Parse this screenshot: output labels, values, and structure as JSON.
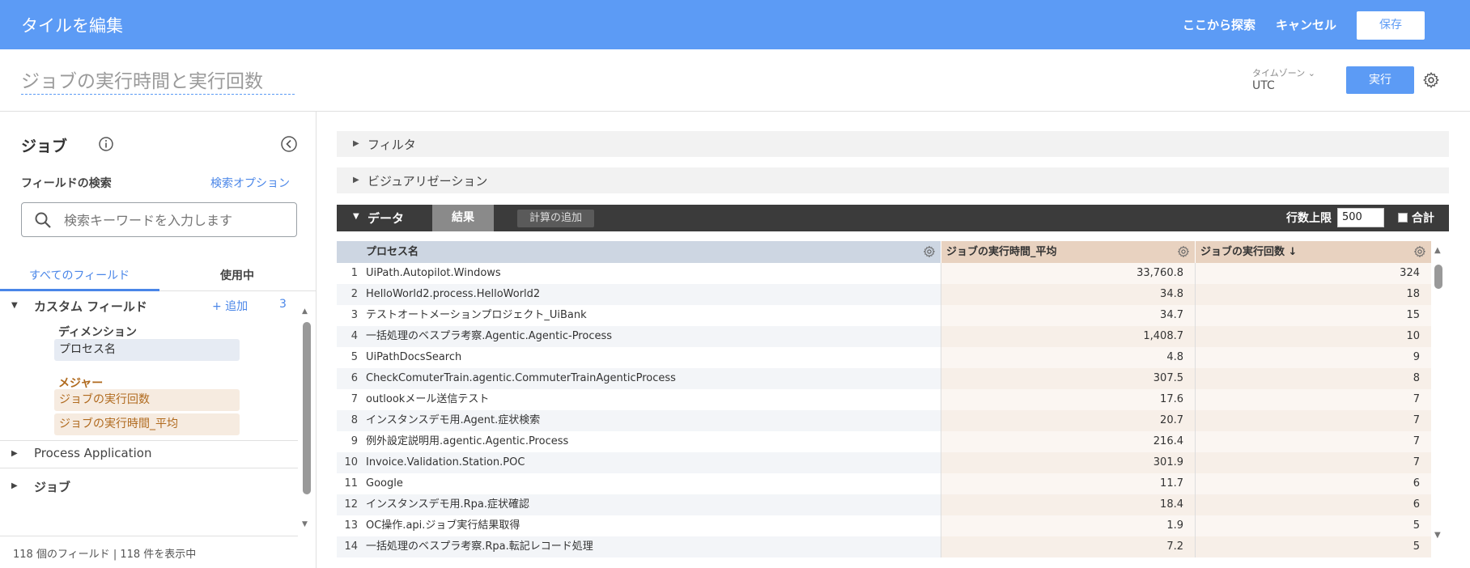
{
  "header": {
    "title": "タイルを編集",
    "explore_label": "ここから探索",
    "cancel_label": "キャンセル",
    "save_label": "保存"
  },
  "tile": {
    "title": "ジョブの実行時間と実行回数",
    "timezone_label": "タイムゾーン",
    "timezone_value": "UTC",
    "run_label": "実行"
  },
  "sidebar": {
    "title": "ジョブ",
    "search_label": "フィールドの検索",
    "search_options": "検索オプション",
    "search_placeholder": "検索キーワードを入力します",
    "tabs": {
      "all": "すべてのフィールド",
      "in_use": "使用中"
    },
    "custom_fields": {
      "label": "カスタム フィールド",
      "add": "+ 追加",
      "count": "3",
      "dimension_label": "ディメンション",
      "dimensions": [
        "プロセス名"
      ],
      "measure_label": "メジャー",
      "measures": [
        "ジョブの実行回数",
        "ジョブの実行時間_平均"
      ]
    },
    "groups": [
      "Process Application",
      "ジョブ"
    ],
    "footer": "118 個のフィールド | 118 件を表示中"
  },
  "panels": {
    "filter": "フィルタ",
    "visualization": "ビジュアリゼーション",
    "data": "データ",
    "results_tab": "結果",
    "add_calc": "計算の追加",
    "row_limit_label": "行数上限",
    "row_limit_value": "500",
    "total_label": "合計"
  },
  "table": {
    "columns": [
      "プロセス名",
      "ジョブの実行時間_平均",
      "ジョブの実行回数 ↓"
    ],
    "rows": [
      {
        "idx": "1",
        "name": "UiPath.Autopilot.Windows",
        "avg": "33,760.8",
        "count": "324"
      },
      {
        "idx": "2",
        "name": "HelloWorld2.process.HelloWorld2",
        "avg": "34.8",
        "count": "18"
      },
      {
        "idx": "3",
        "name": "テストオートメーションプロジェクト_UiBank",
        "avg": "34.7",
        "count": "15"
      },
      {
        "idx": "4",
        "name": "一括処理のベスプラ考察.Agentic.Agentic-Process",
        "avg": "1,408.7",
        "count": "10"
      },
      {
        "idx": "5",
        "name": "UiPathDocsSearch",
        "avg": "4.8",
        "count": "9"
      },
      {
        "idx": "6",
        "name": "CheckComuterTrain.agentic.CommuterTrainAgenticProcess",
        "avg": "307.5",
        "count": "8"
      },
      {
        "idx": "7",
        "name": "outlookメール送信テスト",
        "avg": "17.6",
        "count": "7"
      },
      {
        "idx": "8",
        "name": "インスタンスデモ用.Agent.症状検索",
        "avg": "20.7",
        "count": "7"
      },
      {
        "idx": "9",
        "name": "例外設定説明用.agentic.Agentic.Process",
        "avg": "216.4",
        "count": "7"
      },
      {
        "idx": "10",
        "name": "Invoice.Validation.Station.POC",
        "avg": "301.9",
        "count": "7"
      },
      {
        "idx": "11",
        "name": "Google",
        "avg": "11.7",
        "count": "6"
      },
      {
        "idx": "12",
        "name": "インスタンスデモ用.Rpa.症状確認",
        "avg": "18.4",
        "count": "6"
      },
      {
        "idx": "13",
        "name": "OC操作.api.ジョブ実行結果取得",
        "avg": "1.9",
        "count": "5"
      },
      {
        "idx": "14",
        "name": "一括処理のベスプラ考察.Rpa.転記レコード処理",
        "avg": "7.2",
        "count": "5"
      }
    ]
  },
  "colors": {
    "header_blue": "#5c9bf5",
    "link_blue": "#4a86e8",
    "dimension_bg": "#e6ebf3",
    "measure_bg": "#f6ebe0",
    "measure_text": "#b06a1e"
  }
}
